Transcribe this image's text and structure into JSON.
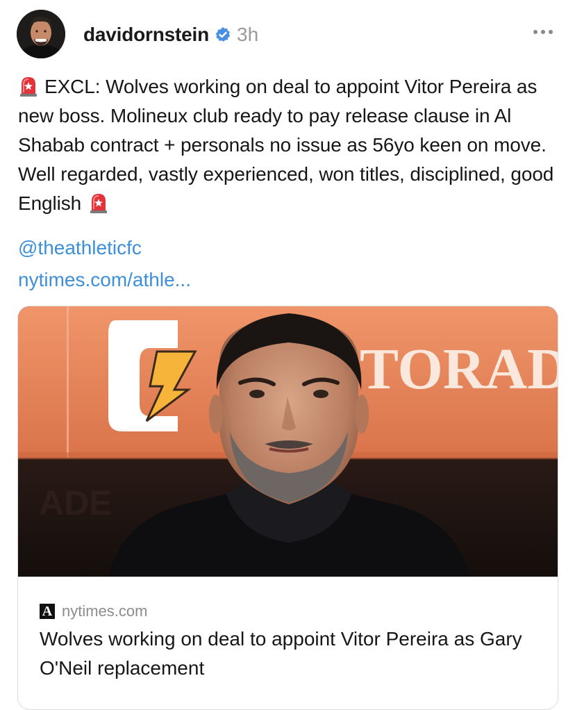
{
  "post": {
    "author": {
      "username": "davidornstein",
      "verified": true,
      "avatar_icon": "avatar-photo"
    },
    "time_ago": "3h",
    "more_icon": "more-horizontal-icon",
    "body": {
      "lead_icon": "rotating-light-emoji",
      "text": "EXCL: Wolves working on deal to appoint Vitor Pereira as new boss. Molineux club ready to pay release clause in Al Shabab contract + personals no issue as 56yo keen on move. Well regarded, vastly experienced, won titles, disciplined, good English",
      "trail_icon": "rotating-light-emoji"
    },
    "links": {
      "mention": "@theathleticfc",
      "url": "nytimes.com/athle..."
    },
    "link_card": {
      "image_alt_icon": "article-photo",
      "image_banner_text": "TORAD",
      "source_logo": "A",
      "source_domain": "nytimes.com",
      "title": "Wolves working on deal to appoint Vitor Pereira as Gary O'Neil replacement"
    },
    "colors": {
      "link": "#3d8fd9",
      "verified": "#4a90e2",
      "muted": "#9a9a9a",
      "banner": "#e98a5c"
    }
  }
}
